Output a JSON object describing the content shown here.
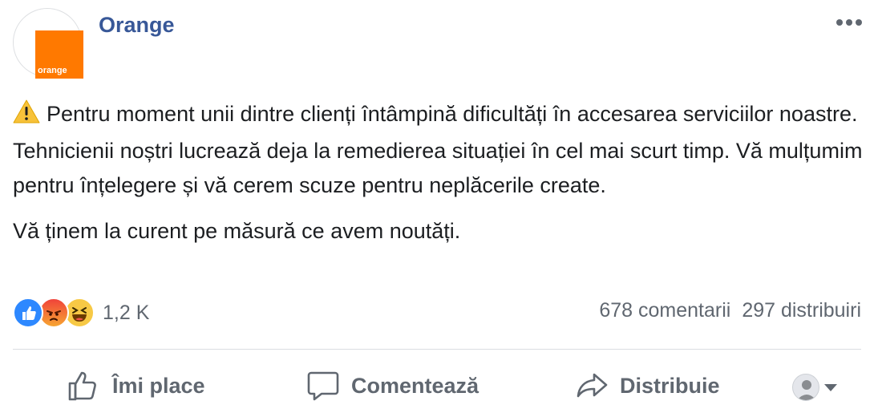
{
  "header": {
    "page_name": "Orange",
    "logo_text": "orange",
    "more_icon": "more-horizontal-icon"
  },
  "post": {
    "warning_icon": "warning-icon",
    "paragraph1": "Pentru moment unii dintre clienți întâmpină dificultăți în accesarea serviciilor noastre. Tehnicienii noștri lucrează deja la remedierea situației în cel mai scurt timp. Vă mulțumim pentru înțelegere și vă cerem scuze pentru neplăcerile create.",
    "paragraph2": "Vă ținem la curent pe măsură ce avem noutăți."
  },
  "reactions": {
    "icons": [
      "like-reaction-icon",
      "angry-reaction-icon",
      "haha-reaction-icon"
    ],
    "count": "1,2 K",
    "comments": "678 comentarii",
    "shares": "297 distribuiri"
  },
  "actions": {
    "like_label": "Îmi place",
    "comment_label": "Comentează",
    "share_label": "Distribuie"
  },
  "colors": {
    "brand_orange": "#ff7900",
    "link_blue": "#385898",
    "text": "#1c1e21",
    "muted": "#606770"
  }
}
